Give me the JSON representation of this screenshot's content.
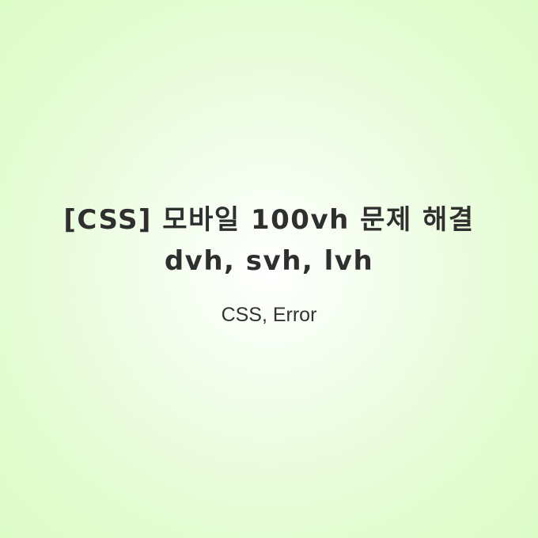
{
  "title": {
    "line1": "[CSS] 모바일 100vh 문제 해결",
    "line2": "dvh, svh, lvh"
  },
  "category": "CSS, Error",
  "colors": {
    "background_center": "#ffffff",
    "background_edge": "#dcfbc6",
    "text": "#2f2f2f"
  }
}
